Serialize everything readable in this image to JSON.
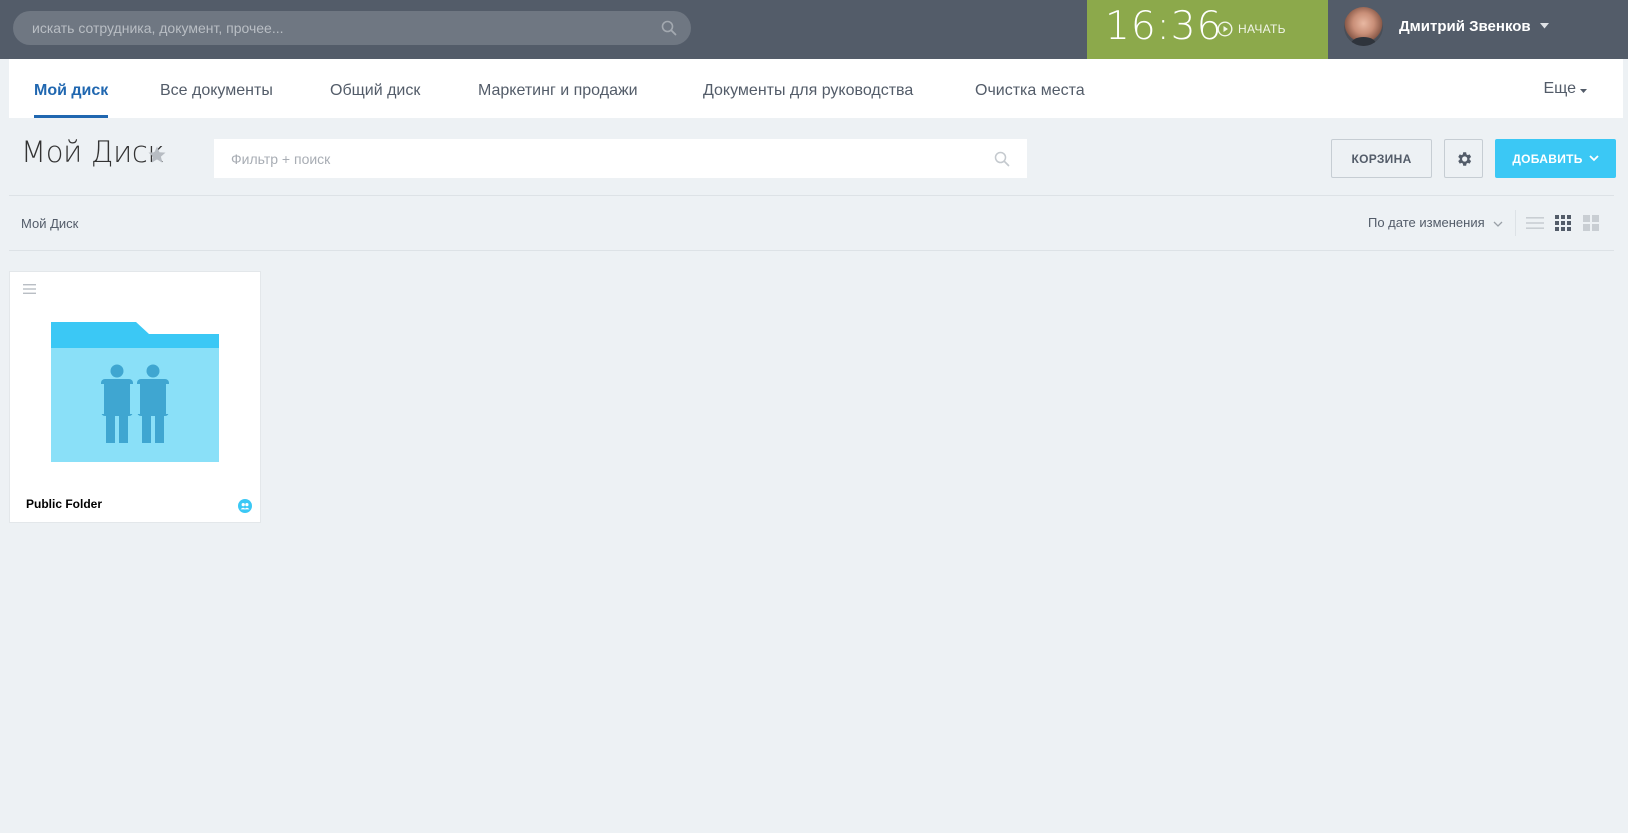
{
  "header": {
    "search_placeholder": "искать сотрудника, документ, прочее...",
    "timer": {
      "time": "16:36",
      "start_label": "НАЧАТЬ",
      "color": "#8ca94b"
    },
    "user": {
      "name": "Дмитрий Звенков"
    },
    "color": "#535c69"
  },
  "tabs": [
    {
      "label": "Мой диск",
      "active": true
    },
    {
      "label": "Все документы"
    },
    {
      "label": "Общий диск"
    },
    {
      "label": "Маркетинг и продажи"
    },
    {
      "label": "Документы для руководства"
    },
    {
      "label": "Очистка места"
    }
  ],
  "tabs_more_label": "Еще",
  "page": {
    "title": "Мой Диск",
    "filter_placeholder": "Фильтр + поиск",
    "trash_label": "КОРЗИНА",
    "add_label": "ДОБАВИТЬ",
    "accent_color": "#3bc8f5"
  },
  "toolbar": {
    "breadcrumb": "Мой Диск",
    "sort_label": "По дате изменения",
    "views": [
      "list-view-icon",
      "grid-view-icon",
      "tile-view-icon"
    ],
    "active_view": "grid-view-icon"
  },
  "items": [
    {
      "name": "Public Folder",
      "type": "shared-folder",
      "icon": "shared-folder-icon"
    }
  ]
}
